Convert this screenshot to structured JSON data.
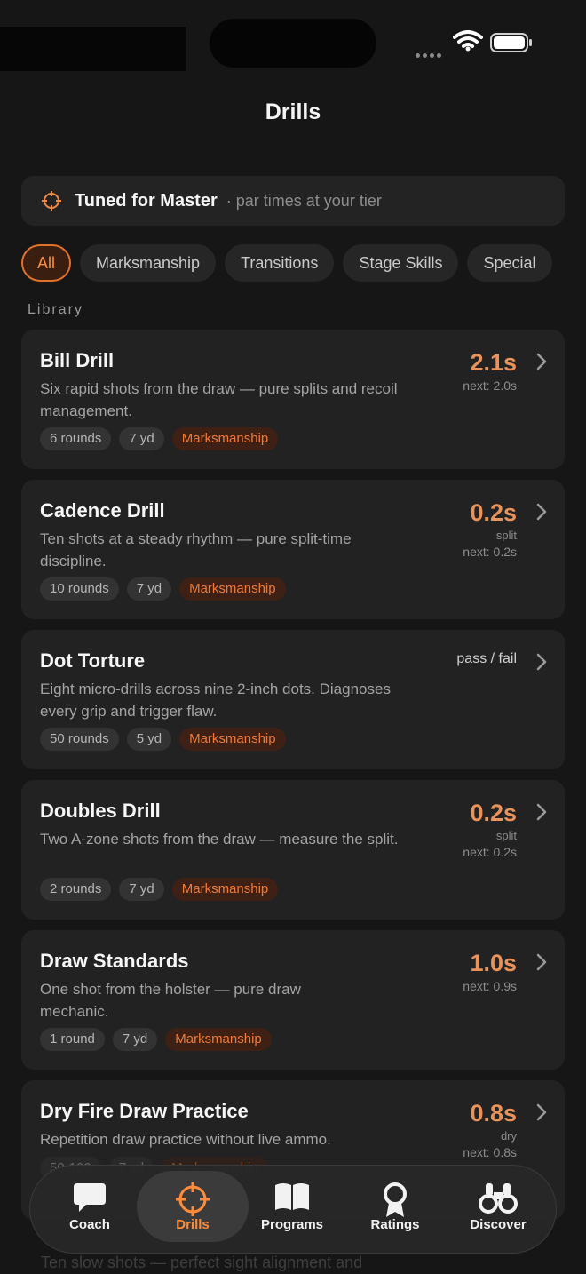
{
  "page": {
    "title": "Drills"
  },
  "tuned": {
    "label": "Tuned for Master",
    "sub": "· par times at your tier"
  },
  "filters": [
    "All",
    "Marksmanship",
    "Transitions",
    "Stage Skills",
    "Special"
  ],
  "section_label": "Library",
  "drills": [
    {
      "title": "Bill Drill",
      "desc": "Six rapid shots from the draw — pure splits and recoil management.",
      "rounds": "6 rounds",
      "distance": "7 yd",
      "category": "Marksmanship",
      "value": "2.1s",
      "unit": "",
      "next": "next: 2.0s"
    },
    {
      "title": "Cadence Drill",
      "desc": "Ten shots at a steady rhythm — pure split-time discipline.",
      "rounds": "10 rounds",
      "distance": "7 yd",
      "category": "Marksmanship",
      "value": "0.2s",
      "unit": "split",
      "next": "next: 0.2s"
    },
    {
      "title": "Dot Torture",
      "desc": "Eight micro-drills across nine 2-inch dots. Diagnoses every grip and trigger flaw.",
      "rounds": "50 rounds",
      "distance": "5 yd",
      "category": "Marksmanship",
      "passfail": "pass / fail"
    },
    {
      "title": "Doubles Drill",
      "desc": "Two A-zone shots from the draw — measure the split.",
      "rounds": "2 rounds",
      "distance": "7 yd",
      "category": "Marksmanship",
      "value": "0.2s",
      "unit": "split",
      "next": "next: 0.2s"
    },
    {
      "title": "Draw Standards",
      "desc": "One shot from the holster — pure draw mechanic.",
      "rounds": "1 round",
      "distance": "7 yd",
      "category": "Marksmanship",
      "value": "1.0s",
      "unit": "",
      "next": "next: 0.9s"
    },
    {
      "title": "Dry Fire Draw Practice",
      "desc": "Repetition draw practice without live ammo.",
      "rounds": "50-100",
      "distance": "7 yd",
      "category": "Marksmanship",
      "value": "0.8s",
      "unit": "dry",
      "next": "next: 0.8s"
    }
  ],
  "ghost_text": "Ten slow shots — perfect sight alignment and",
  "tabs": [
    {
      "label": "Coach",
      "icon": "chat-bubble-icon"
    },
    {
      "label": "Drills",
      "icon": "crosshair-icon"
    },
    {
      "label": "Programs",
      "icon": "book-icon"
    },
    {
      "label": "Ratings",
      "icon": "award-icon"
    },
    {
      "label": "Discover",
      "icon": "binoculars-icon"
    }
  ],
  "colors": {
    "accent": "#ff8c3a",
    "background": "#161616",
    "card": "#222222"
  }
}
